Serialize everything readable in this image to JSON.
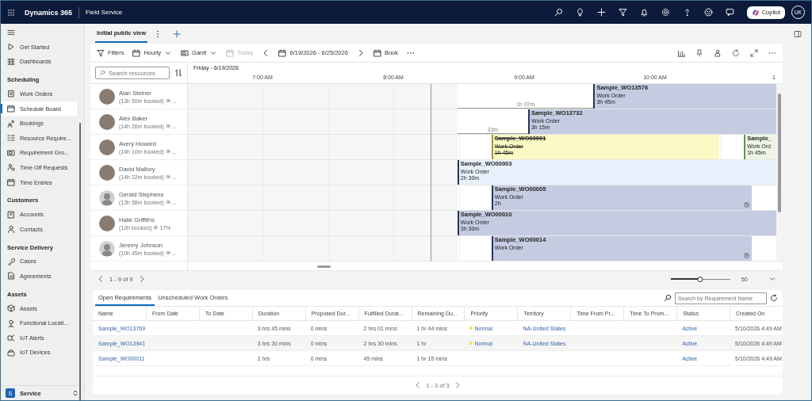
{
  "app_bar": {
    "brand": "Dynamics 365",
    "app": "Field Service",
    "copilot": "Copilot",
    "user_initials": "UK"
  },
  "sidebar": {
    "groups": [
      {
        "items": [
          {
            "label": "Get Started",
            "selected": false
          },
          {
            "label": "Dashboards",
            "selected": false
          }
        ]
      },
      {
        "title": "Scheduling",
        "items": [
          {
            "label": "Work Orders",
            "selected": false
          },
          {
            "label": "Schedule Board",
            "selected": true
          },
          {
            "label": "Bookings",
            "selected": false
          },
          {
            "label": "Resource Require...",
            "selected": false
          },
          {
            "label": "Requirement Gro...",
            "selected": false
          },
          {
            "label": "Time Off Requests",
            "selected": false
          },
          {
            "label": "Time Entries",
            "selected": false
          }
        ]
      },
      {
        "title": "Customers",
        "items": [
          {
            "label": "Accounts",
            "selected": false
          },
          {
            "label": "Contacts",
            "selected": false
          }
        ]
      },
      {
        "title": "Service Delivery",
        "items": [
          {
            "label": "Cases",
            "selected": false
          },
          {
            "label": "Agreements",
            "selected": false
          }
        ]
      },
      {
        "title": "Assets",
        "items": [
          {
            "label": "Assets",
            "selected": false
          },
          {
            "label": "Functional Locati...",
            "selected": false
          },
          {
            "label": "IoT Alerts",
            "selected": false
          },
          {
            "label": "IoT Devices",
            "selected": false
          }
        ]
      }
    ],
    "area": {
      "badge": "S",
      "label": "Service"
    }
  },
  "view_tabs": [
    {
      "label": "Initial public view",
      "selected": true
    }
  ],
  "toolbar": {
    "filters": "Filters",
    "timescale": "Hourly",
    "view": "Gantt",
    "today": {
      "label": "Today",
      "disabled": true
    },
    "date_range": "6/19/2026 - 6/25/2026",
    "book": "Book"
  },
  "schedule": {
    "search": {
      "placeholder": "Search resources"
    },
    "date": "Friday - 6/19/2026",
    "hours": [
      "7:00 AM",
      "8:00 AM",
      "9:00 AM",
      "10:00 AM",
      "1"
    ],
    "resources": [
      {
        "name": "Alan Steiner",
        "booked": "(13h 50m booked)",
        "utilization": "...",
        "kind": "photo",
        "travel": "1h 02m",
        "bookings": [
          {
            "title": "Sample_WO13576",
            "type": "Work Order",
            "duration": "3h 45m",
            "kind": "scheduled",
            "struck": false,
            "clock": false
          }
        ]
      },
      {
        "name": "Alex Baker",
        "booked": "(14h 26m booked)",
        "utilization": "...",
        "kind": "photo",
        "travel": "33m",
        "bookings": [
          {
            "title": "Sample_WO13732",
            "type": "Work Order",
            "duration": "3h 15m",
            "kind": "scheduled",
            "struck": false,
            "clock": false
          }
        ]
      },
      {
        "name": "Avery Howard",
        "booked": "(14h 10m booked)",
        "utilization": "...",
        "kind": "photo",
        "bookings": [
          {
            "title": "Sample_WO00001",
            "type": "Work Order",
            "duration": "1h 45m",
            "kind": "tentative",
            "struck": true,
            "clock": false
          },
          {
            "title": "Sample_",
            "type": "Work Ord",
            "duration": "1h 45m",
            "kind": "confirmed",
            "struck": false,
            "clock": false
          }
        ]
      },
      {
        "name": "David Mallory",
        "booked": "(14h 22m booked)",
        "utilization": "...",
        "kind": "photo",
        "bookings": [
          {
            "title": "Sample_WO00003",
            "type": "Work Order",
            "duration": "2h 30m",
            "kind": "highlighted",
            "struck": false,
            "clock": false
          }
        ]
      },
      {
        "name": "Gerald Stephens",
        "booked": "(13h 58m booked)",
        "utilization": "...",
        "kind": "silhouette",
        "bookings": [
          {
            "title": "Sample_WO00005",
            "type": "Work Order",
            "duration": "2h",
            "kind": "scheduled",
            "struck": false,
            "clock": true
          }
        ]
      },
      {
        "name": "Halle Griffiths",
        "booked": "(12h booked)",
        "utilization": "17%",
        "kind": "photo",
        "bookings": [
          {
            "title": "Sample_WO00010",
            "type": "Work Order",
            "duration": "3h 30m",
            "kind": "scheduled",
            "struck": false,
            "clock": false
          }
        ]
      },
      {
        "name": "Jeremy Johnson",
        "booked": "(10h 45m booked)",
        "utilization": "...",
        "kind": "silhouette",
        "bookings": [
          {
            "title": "Sample_WO00014",
            "type": "Work Order",
            "kind": "scheduled",
            "struck": false,
            "clock": true
          }
        ]
      }
    ],
    "pager": "1 - 9 of 9",
    "zoom": {
      "level": 0.5,
      "reading": "50"
    }
  },
  "requirements": {
    "tabs": [
      {
        "label": "Open Requirements",
        "selected": true
      },
      {
        "label": "Unscheduled Work Orders",
        "selected": false
      }
    ],
    "search": {
      "placeholder": "Search by Requirement Name"
    },
    "columns": [
      "Name",
      "From Date",
      "To Date",
      "Duration",
      "Proposed Dur...",
      "Fulfilled Durat...",
      "Remaining Du...",
      "Priority",
      "Territory",
      "Time From Pr...",
      "Time To Prom...",
      "Status",
      "Created On"
    ],
    "rows": [
      {
        "name": "Sample_WO13769",
        "duration": "3 hrs 45 mins",
        "proposed": "0 mins",
        "fulfilled": "2 hrs 01 mins",
        "remaining": "1 hr 44 mins",
        "priority": {
          "label": "Normal",
          "color": "#f2e33a"
        },
        "territory": "NA-United States",
        "status": "Active",
        "created_on": "5/10/2026 4:49 AM"
      },
      {
        "name": "Sample_WO13941",
        "duration": "3 hrs 30 mins",
        "proposed": "0 mins",
        "fulfilled": "2 hrs 30 mins",
        "remaining": "1 hr",
        "priority": {
          "label": "Normal",
          "color": "#f2e33a"
        },
        "territory": "NA-United States",
        "status": "Active",
        "created_on": "5/10/2026 4:49 AM"
      },
      {
        "name": "Sample_WO00011",
        "duration": "2 hrs",
        "proposed": "0 mins",
        "fulfilled": "45 mins",
        "remaining": "1 hr 15 mins",
        "status": "Active",
        "created_on": "5/10/2026 4:49 AM"
      }
    ],
    "pager": "1 - 3 of 3"
  }
}
